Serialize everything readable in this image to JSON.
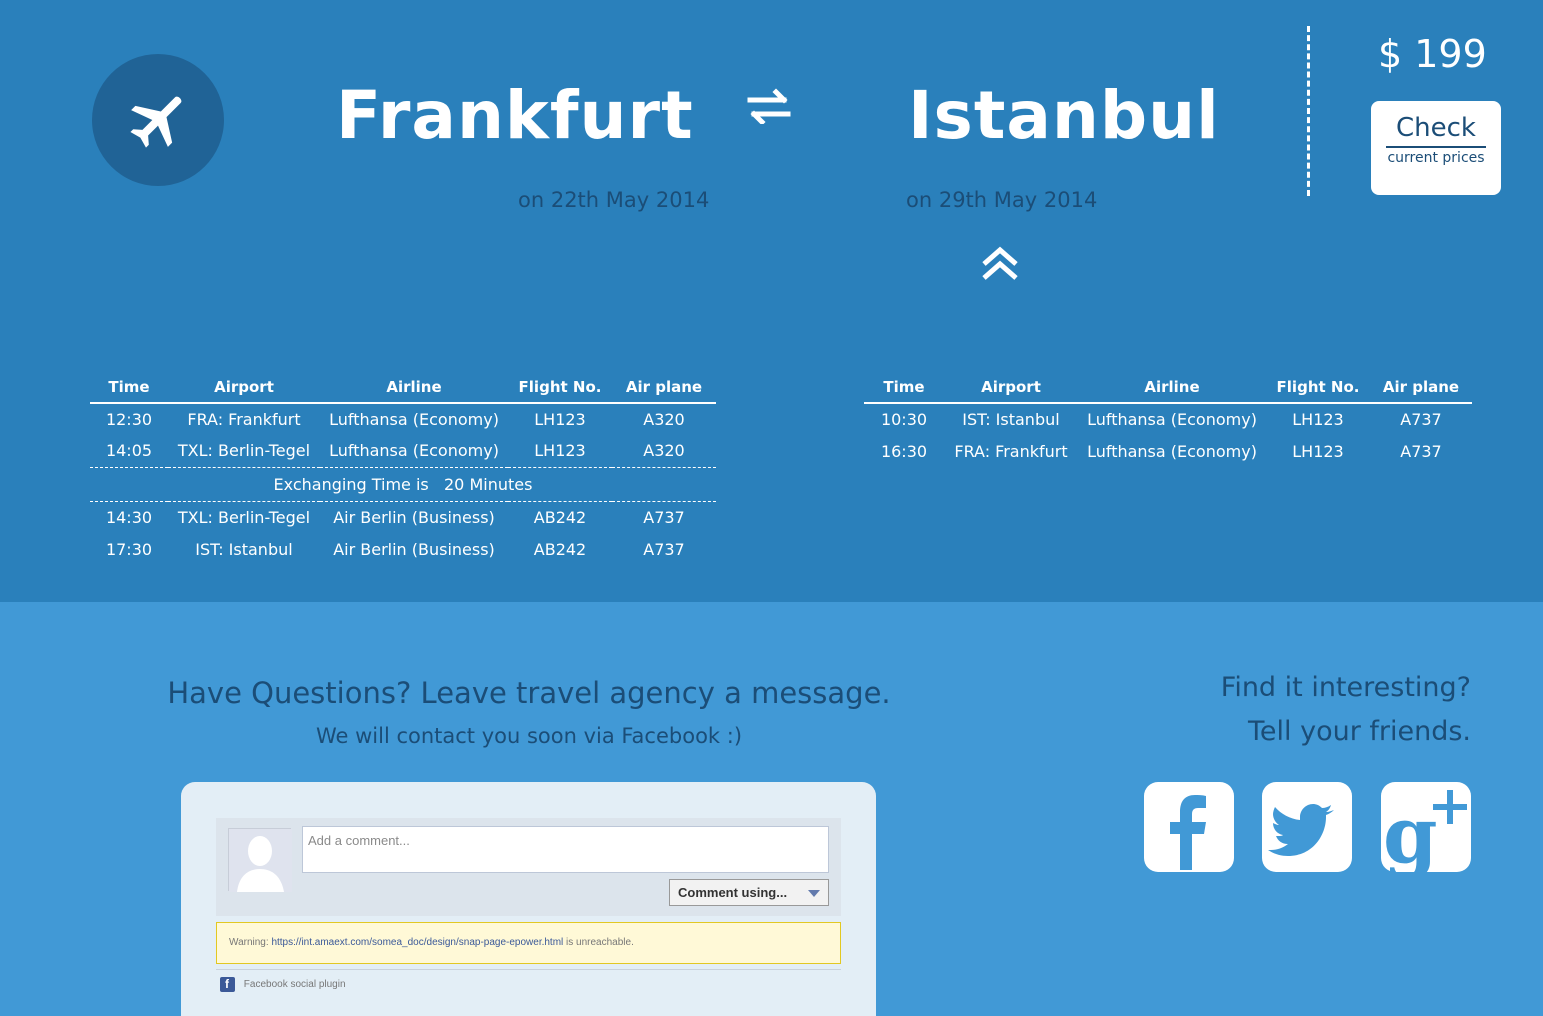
{
  "route": {
    "from_city": "Frankfurt",
    "to_city": "Istanbul",
    "from_date": "on 22th May 2014",
    "to_date": "on 29th May 2014"
  },
  "pricing": {
    "price": "$ 199",
    "check_big": "Check",
    "check_small": "current prices"
  },
  "icons": [
    "airplane-icon",
    "swap-arrows-icon",
    "double-chevron-up-icon",
    "facebook-icon",
    "twitter-icon",
    "google-plus-icon"
  ],
  "outbound": {
    "headers": [
      "Time",
      "Airport",
      "Airline",
      "Flight No.",
      "Air plane"
    ],
    "rows_before": [
      [
        "12:30",
        "FRA: Frankfurt",
        "Lufthansa (Economy)",
        "LH123",
        "A320"
      ],
      [
        "14:05",
        "TXL: Berlin-Tegel",
        "Lufthansa (Economy)",
        "LH123",
        "A320"
      ]
    ],
    "exchange_label": "Exchanging Time is",
    "exchange_value": "20 Minutes",
    "rows_after": [
      [
        "14:30",
        "TXL: Berlin-Tegel",
        "Air Berlin (Business)",
        "AB242",
        "A737"
      ],
      [
        "17:30",
        "IST: Istanbul",
        "Air Berlin (Business)",
        "AB242",
        "A737"
      ]
    ]
  },
  "return": {
    "headers": [
      "Time",
      "Airport",
      "Airline",
      "Flight No.",
      "Air plane"
    ],
    "rows": [
      [
        "10:30",
        "IST: Istanbul",
        "Lufthansa (Economy)",
        "LH123",
        "A737"
      ],
      [
        "16:30",
        "FRA: Frankfurt",
        "Lufthansa (Economy)",
        "LH123",
        "A737"
      ]
    ]
  },
  "questions": {
    "title": "Have Questions? Leave travel agency a message.",
    "subtitle": "We will contact you soon via Facebook :)"
  },
  "share": {
    "line1": "Find it interesting?",
    "line2": "Tell your friends."
  },
  "fb_comments": {
    "placeholder": "Add a comment...",
    "button": "Comment using...",
    "warning_prefix": "Warning:",
    "warning_url": "https://int.amaext.com/somea_doc/design/snap-page-epower.html",
    "warning_suffix": "is unreachable.",
    "plugin_label": "Facebook social plugin"
  },
  "colors": {
    "top_bg": "#2a80bb",
    "bottom_bg": "#4199d6",
    "dark_text": "#1b4d77",
    "circle": "#206396"
  }
}
